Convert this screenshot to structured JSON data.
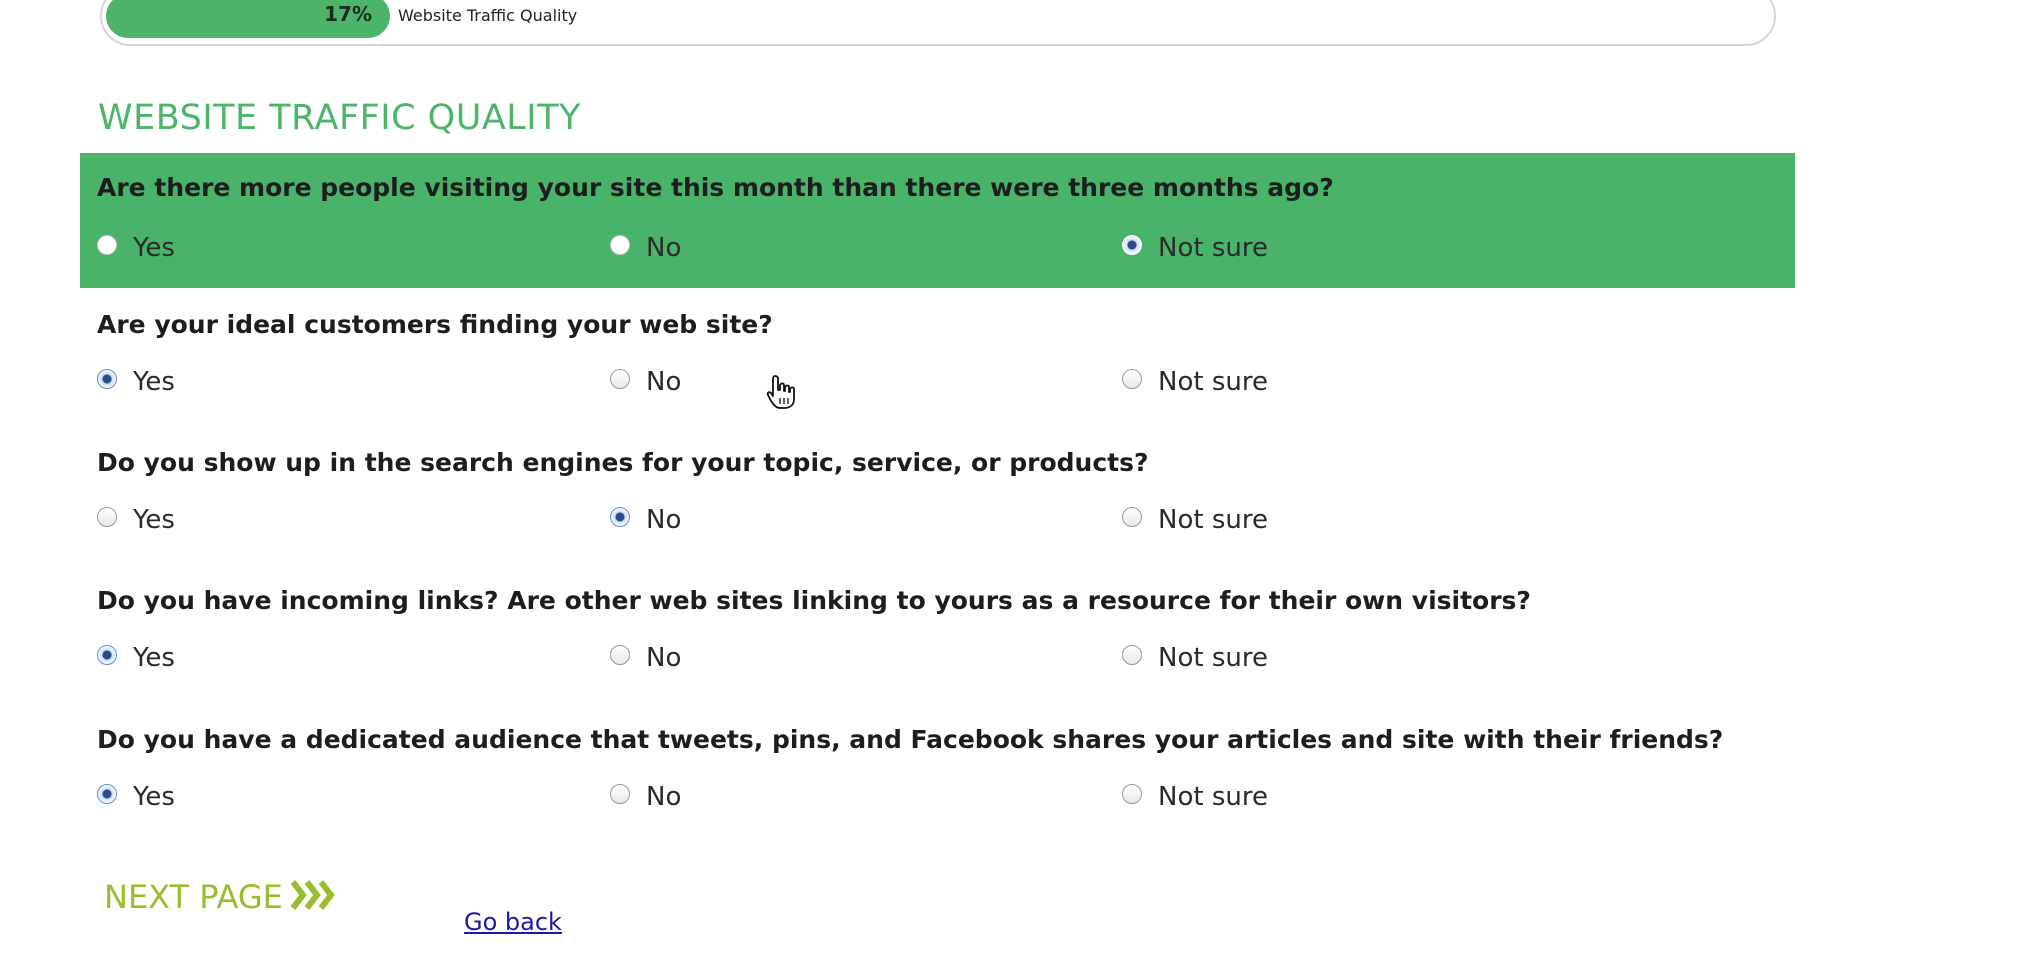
{
  "progress": {
    "percent_label": "17%",
    "label": "Website Traffic Quality",
    "fraction": 0.17
  },
  "section_title": "WEBSITE TRAFFIC QUALITY",
  "colors": {
    "accent_green": "#4db56a",
    "highlight_green": "#4ab36a",
    "next_green": "#95bf2c",
    "link_blue": "#1a1aa6"
  },
  "questions": [
    {
      "text": "Are there more people visiting your site this month than there were three months ago?",
      "options": [
        "Yes",
        "No",
        "Not sure"
      ],
      "selected": "Not sure",
      "highlighted": true
    },
    {
      "text": "Are your ideal customers finding your web site?",
      "options": [
        "Yes",
        "No",
        "Not sure"
      ],
      "selected": "Yes",
      "highlighted": false
    },
    {
      "text": "Do you show up in the search engines for your topic, service, or products?",
      "options": [
        "Yes",
        "No",
        "Not sure"
      ],
      "selected": "No",
      "highlighted": false
    },
    {
      "text": "Do you have incoming links? Are other web sites linking to yours as a resource for their own visitors?",
      "options": [
        "Yes",
        "No",
        "Not sure"
      ],
      "selected": "Yes",
      "highlighted": false
    },
    {
      "text": "Do you have a dedicated audience that tweets, pins, and Facebook shares your articles and site with their friends?",
      "options": [
        "Yes",
        "No",
        "Not sure"
      ],
      "selected": "Yes",
      "highlighted": false
    }
  ],
  "next_button": {
    "label": "NEXT PAGE",
    "icon": "triple-chevron-right-icon"
  },
  "go_back_link": "Go back",
  "cursor": {
    "icon": "hand-pointer-icon"
  }
}
